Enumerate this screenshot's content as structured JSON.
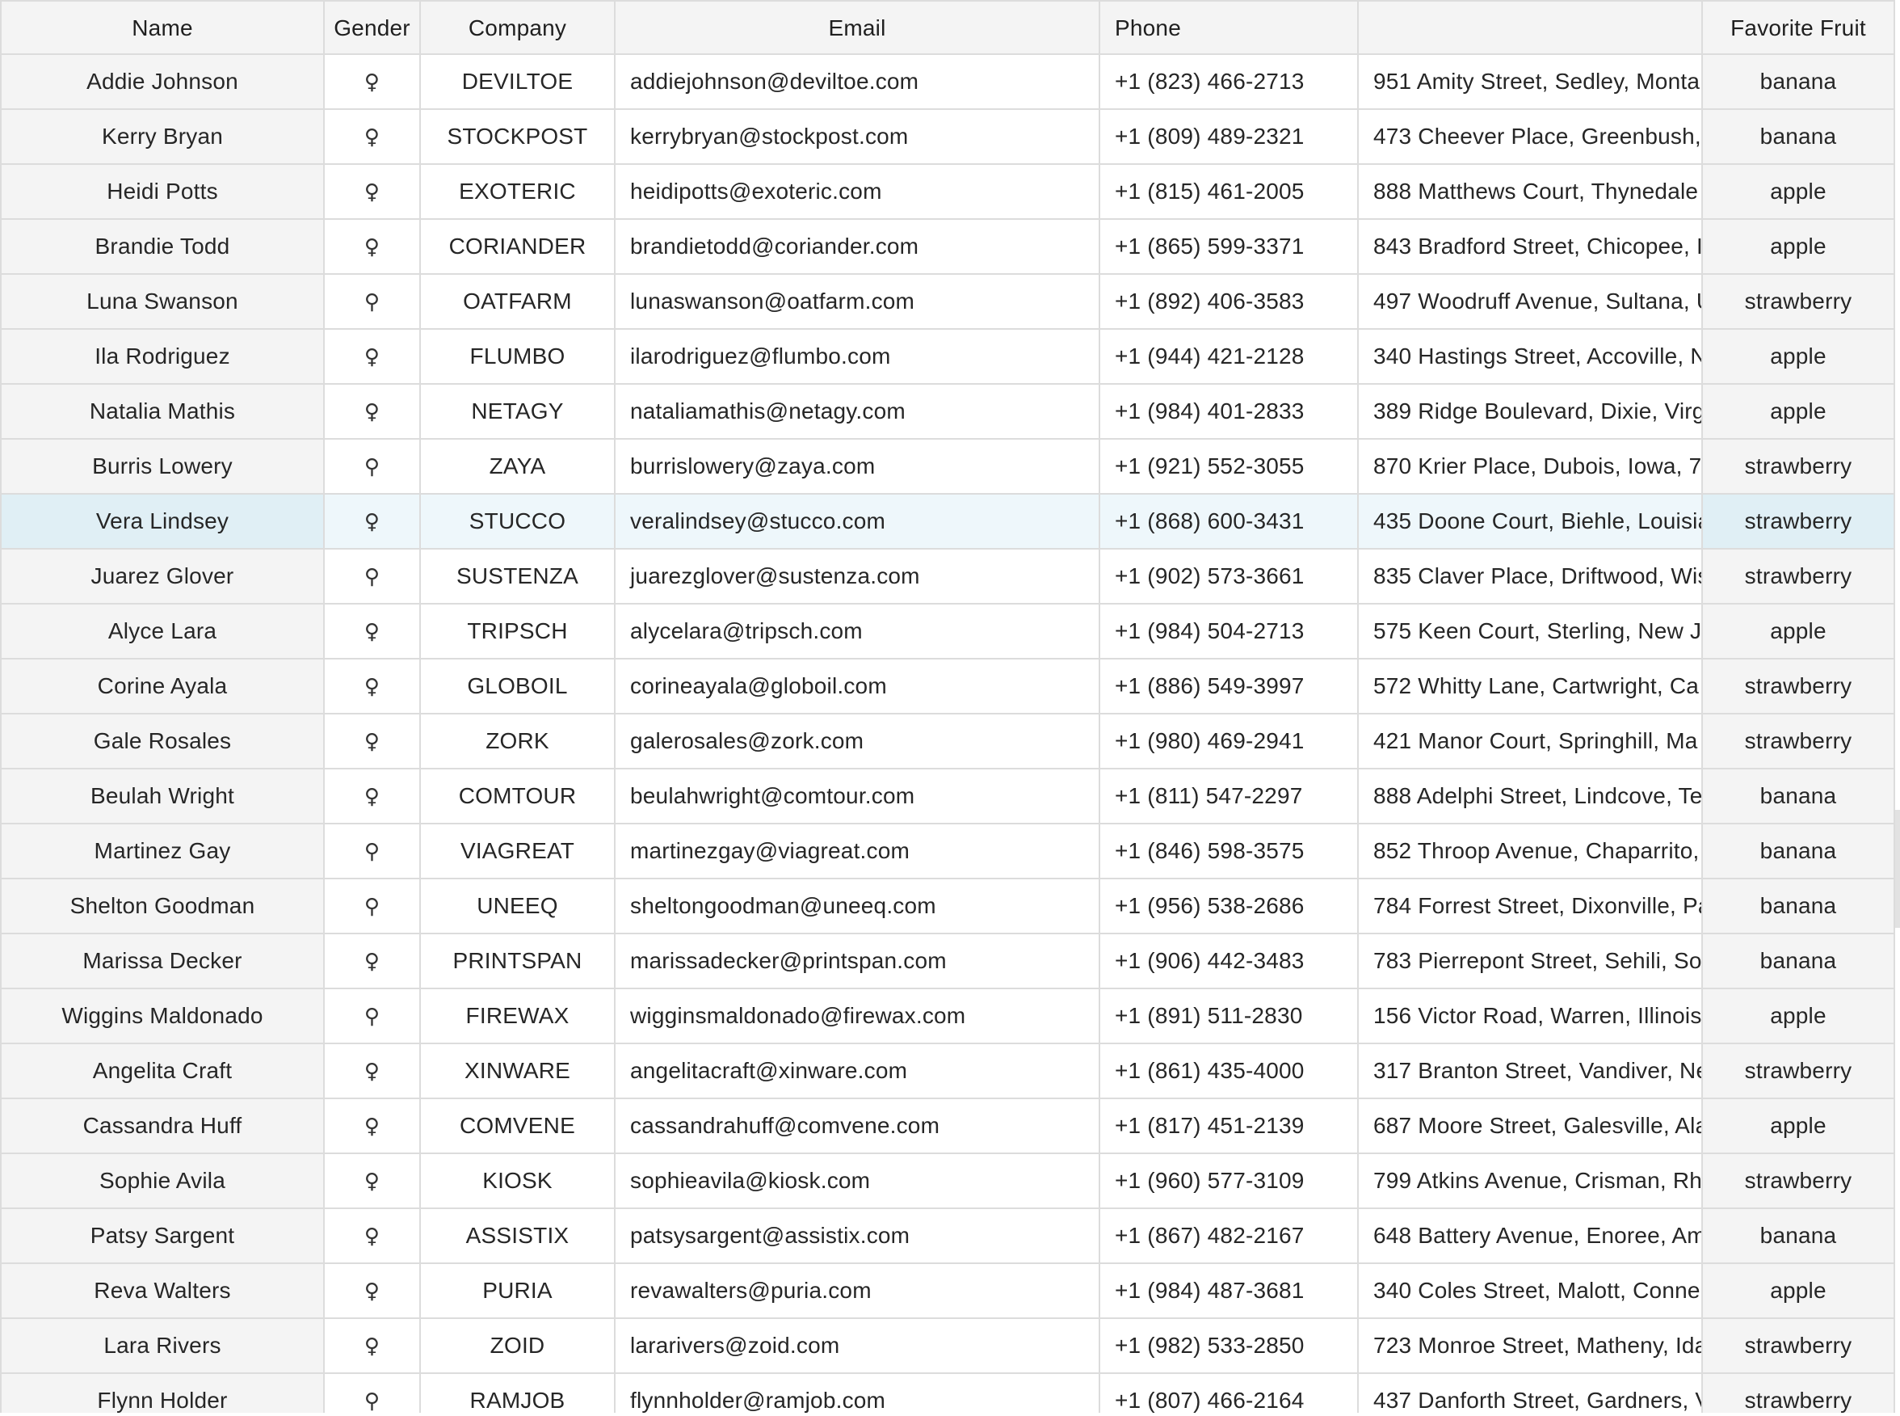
{
  "columns": {
    "name": "Name",
    "gender": "Gender",
    "company": "Company",
    "email": "Email",
    "phone": "Phone",
    "address": "",
    "fruit": "Favorite Fruit"
  },
  "gender_symbols": {
    "female": "♀",
    "male": "⚲"
  },
  "selected_row_index": 8,
  "rows": [
    {
      "name": "Addie Johnson",
      "gender": "female",
      "company": "DEVILTOE",
      "email": "addiejohnson@deviltoe.com",
      "phone": "+1 (823) 466-2713",
      "address": "951 Amity Street, Sedley, Monta",
      "fruit": "banana"
    },
    {
      "name": "Kerry Bryan",
      "gender": "female",
      "company": "STOCKPOST",
      "email": "kerrybryan@stockpost.com",
      "phone": "+1 (809) 489-2321",
      "address": "473 Cheever Place, Greenbush, ",
      "fruit": "banana"
    },
    {
      "name": "Heidi Potts",
      "gender": "female",
      "company": "EXOTERIC",
      "email": "heidipotts@exoteric.com",
      "phone": "+1 (815) 461-2005",
      "address": "888 Matthews Court, Thynedale",
      "fruit": "apple"
    },
    {
      "name": "Brandie Todd",
      "gender": "female",
      "company": "CORIANDER",
      "email": "brandietodd@coriander.com",
      "phone": "+1 (865) 599-3371",
      "address": "843 Bradford Street, Chicopee, I",
      "fruit": "apple"
    },
    {
      "name": "Luna Swanson",
      "gender": "male",
      "company": "OATFARM",
      "email": "lunaswanson@oatfarm.com",
      "phone": "+1 (892) 406-3583",
      "address": "497 Woodruff Avenue, Sultana, U",
      "fruit": "strawberry"
    },
    {
      "name": "Ila Rodriguez",
      "gender": "female",
      "company": "FLUMBO",
      "email": "ilarodriguez@flumbo.com",
      "phone": "+1 (944) 421-2128",
      "address": "340 Hastings Street, Accoville, N",
      "fruit": "apple"
    },
    {
      "name": "Natalia Mathis",
      "gender": "female",
      "company": "NETAGY",
      "email": "nataliamathis@netagy.com",
      "phone": "+1 (984) 401-2833",
      "address": "389 Ridge Boulevard, Dixie, Virg",
      "fruit": "apple"
    },
    {
      "name": "Burris Lowery",
      "gender": "male",
      "company": "ZAYA",
      "email": "burrislowery@zaya.com",
      "phone": "+1 (921) 552-3055",
      "address": "870 Krier Place, Dubois, Iowa, 7",
      "fruit": "strawberry"
    },
    {
      "name": "Vera Lindsey",
      "gender": "female",
      "company": "STUCCO",
      "email": "veralindsey@stucco.com",
      "phone": "+1 (868) 600-3431",
      "address": "435 Doone Court, Biehle, Louisia",
      "fruit": "strawberry"
    },
    {
      "name": "Juarez Glover",
      "gender": "male",
      "company": "SUSTENZA",
      "email": "juarezglover@sustenza.com",
      "phone": "+1 (902) 573-3661",
      "address": "835 Claver Place, Driftwood, Wis",
      "fruit": "strawberry"
    },
    {
      "name": "Alyce Lara",
      "gender": "female",
      "company": "TRIPSCH",
      "email": "alycelara@tripsch.com",
      "phone": "+1 (984) 504-2713",
      "address": "575 Keen Court, Sterling, New J",
      "fruit": "apple"
    },
    {
      "name": "Corine Ayala",
      "gender": "female",
      "company": "GLOBOIL",
      "email": "corineayala@globoil.com",
      "phone": "+1 (886) 549-3997",
      "address": "572 Whitty Lane, Cartwright, Ca",
      "fruit": "strawberry"
    },
    {
      "name": "Gale Rosales",
      "gender": "female",
      "company": "ZORK",
      "email": "galerosales@zork.com",
      "phone": "+1 (980) 469-2941",
      "address": "421 Manor Court, Springhill, Ma",
      "fruit": "strawberry"
    },
    {
      "name": "Beulah Wright",
      "gender": "female",
      "company": "COMTOUR",
      "email": "beulahwright@comtour.com",
      "phone": "+1 (811) 547-2297",
      "address": "888 Adelphi Street, Lindcove, Te",
      "fruit": "banana"
    },
    {
      "name": "Martinez Gay",
      "gender": "male",
      "company": "VIAGREAT",
      "email": "martinezgay@viagreat.com",
      "phone": "+1 (846) 598-3575",
      "address": "852 Throop Avenue, Chaparrito, ",
      "fruit": "banana"
    },
    {
      "name": "Shelton Goodman",
      "gender": "male",
      "company": "UNEEQ",
      "email": "sheltongoodman@uneeq.com",
      "phone": "+1 (956) 538-2686",
      "address": "784 Forrest Street, Dixonville, Pa",
      "fruit": "banana"
    },
    {
      "name": "Marissa Decker",
      "gender": "female",
      "company": "PRINTSPAN",
      "email": "marissadecker@printspan.com",
      "phone": "+1 (906) 442-3483",
      "address": "783 Pierrepont Street, Sehili, So",
      "fruit": "banana"
    },
    {
      "name": "Wiggins Maldonado",
      "gender": "male",
      "company": "FIREWAX",
      "email": "wigginsmaldonado@firewax.com",
      "phone": "+1 (891) 511-2830",
      "address": "156 Victor Road, Warren, Illinois",
      "fruit": "apple"
    },
    {
      "name": "Angelita Craft",
      "gender": "female",
      "company": "XINWARE",
      "email": "angelitacraft@xinware.com",
      "phone": "+1 (861) 435-4000",
      "address": "317 Branton Street, Vandiver, Ne",
      "fruit": "strawberry"
    },
    {
      "name": "Cassandra Huff",
      "gender": "female",
      "company": "COMVENE",
      "email": "cassandrahuff@comvene.com",
      "phone": "+1 (817) 451-2139",
      "address": "687 Moore Street, Galesville, Ala",
      "fruit": "apple"
    },
    {
      "name": "Sophie Avila",
      "gender": "female",
      "company": "KIOSK",
      "email": "sophieavila@kiosk.com",
      "phone": "+1 (960) 577-3109",
      "address": "799 Atkins Avenue, Crisman, Rh",
      "fruit": "strawberry"
    },
    {
      "name": "Patsy Sargent",
      "gender": "female",
      "company": "ASSISTIX",
      "email": "patsysargent@assistix.com",
      "phone": "+1 (867) 482-2167",
      "address": "648 Battery Avenue, Enoree, Am",
      "fruit": "banana"
    },
    {
      "name": "Reva Walters",
      "gender": "female",
      "company": "PURIA",
      "email": "revawalters@puria.com",
      "phone": "+1 (984) 487-3681",
      "address": "340 Coles Street, Malott, Conne",
      "fruit": "apple"
    },
    {
      "name": "Lara Rivers",
      "gender": "female",
      "company": "ZOID",
      "email": "lararivers@zoid.com",
      "phone": "+1 (982) 533-2850",
      "address": "723 Monroe Street, Matheny, Ida",
      "fruit": "strawberry"
    },
    {
      "name": "Flynn Holder",
      "gender": "male",
      "company": "RAMJOB",
      "email": "flynnholder@ramjob.com",
      "phone": "+1 (807) 466-2164",
      "address": "437 Danforth Street, Gardners, V",
      "fruit": "strawberry"
    }
  ]
}
